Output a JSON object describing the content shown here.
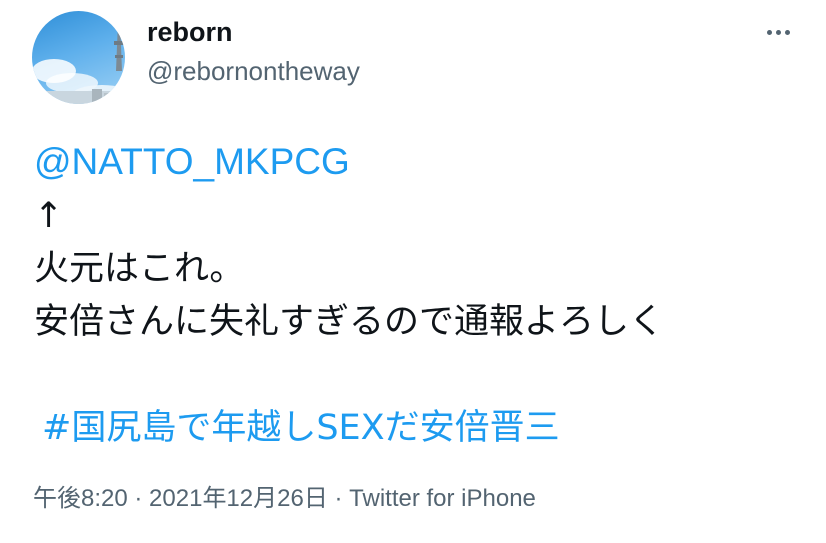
{
  "author": {
    "display_name": "reborn",
    "handle": "@rebornontheway"
  },
  "icons": {
    "avatar": "avatar-sky-tower",
    "more": "more-horizontal-icon"
  },
  "tweet": {
    "mention": "@NATTO_MKPCG",
    "arrow": "↑",
    "line1": "火元はこれ。",
    "line2": "安倍さんに失礼すぎるので通報よろしく",
    "hashtag": "#国尻島で年越しSEXだ安倍晋三"
  },
  "meta": {
    "time": "午後8:20",
    "sep1": " · ",
    "date": "2021年12月26日",
    "sep2": " · ",
    "source": "Twitter for iPhone"
  },
  "colors": {
    "link": "#1d9bf0",
    "secondary": "#536471",
    "text": "#0f1419"
  }
}
